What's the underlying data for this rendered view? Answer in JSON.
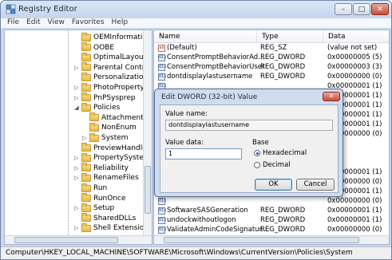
{
  "window": {
    "title": "Registry Editor",
    "min": "–",
    "max": "□",
    "close": "✕"
  },
  "menu": [
    "File",
    "Edit",
    "View",
    "Favorites",
    "Help"
  ],
  "tree": [
    {
      "label": "OEMInformation",
      "expander": "",
      "indent": 0
    },
    {
      "label": "OOBE",
      "expander": "",
      "indent": 0
    },
    {
      "label": "OptimalLayout",
      "expander": "",
      "indent": 0
    },
    {
      "label": "Parental Controls",
      "expander": "▷",
      "indent": 0
    },
    {
      "label": "Personalization",
      "expander": "",
      "indent": 0
    },
    {
      "label": "PhotoPropertyHandler",
      "expander": "▷",
      "indent": 0
    },
    {
      "label": "PnPSysprep",
      "expander": "▷",
      "indent": 0
    },
    {
      "label": "Policies",
      "expander": "◢",
      "indent": 0
    },
    {
      "label": "Attachments",
      "expander": "",
      "indent": 1
    },
    {
      "label": "NonEnum",
      "expander": "",
      "indent": 1
    },
    {
      "label": "System",
      "expander": "▷",
      "indent": 1
    },
    {
      "label": "PreviewHandlers",
      "expander": "",
      "indent": 0
    },
    {
      "label": "PropertySystem",
      "expander": "▷",
      "indent": 0
    },
    {
      "label": "Reliability",
      "expander": "▷",
      "indent": 0
    },
    {
      "label": "RenameFiles",
      "expander": "▷",
      "indent": 0
    },
    {
      "label": "Run",
      "expander": "",
      "indent": 0
    },
    {
      "label": "RunOnce",
      "expander": "",
      "indent": 0
    },
    {
      "label": "Setup",
      "expander": "▷",
      "indent": 0
    },
    {
      "label": "SharedDLLs",
      "expander": "",
      "indent": 0
    },
    {
      "label": "Shell Extensions",
      "expander": "▷",
      "indent": 0
    }
  ],
  "columns": {
    "name": "Name",
    "type": "Type",
    "data": "Data"
  },
  "values": [
    {
      "icon": "ab",
      "name": "(Default)",
      "type": "REG_SZ",
      "data": "(value not set)"
    },
    {
      "icon": "011",
      "name": "ConsentPromptBehaviorAd...",
      "type": "REG_DWORD",
      "data": "0x00000005 (5)"
    },
    {
      "icon": "011",
      "name": "ConsentPromptBehaviorUser",
      "type": "REG_DWORD",
      "data": "0x00000003 (3)"
    },
    {
      "icon": "011",
      "name": "dontdisplaylastusername",
      "type": "REG_DWORD",
      "data": "0x00000000 (0)"
    },
    {
      "icon": "011",
      "name": "",
      "type": "",
      "data": "0x00000001 (1)"
    },
    {
      "icon": "011",
      "name": "",
      "type": "",
      "data": "0x00000001 (1)"
    },
    {
      "icon": "011",
      "name": "",
      "type": "",
      "data": "0x00000001 (1)"
    },
    {
      "icon": "011",
      "name": "",
      "type": "",
      "data": "0x00000001 (1)"
    },
    {
      "icon": "011",
      "name": "",
      "type": "",
      "data": "0x00000001 (1)"
    },
    {
      "icon": "011",
      "name": "",
      "type": "",
      "data": "0x00000000 (0)"
    },
    {
      "icon": "011",
      "name": "",
      "type": "",
      "data": ""
    },
    {
      "icon": "011",
      "name": "",
      "type": "",
      "data": ""
    },
    {
      "icon": "011",
      "name": "",
      "type": "",
      "data": ""
    },
    {
      "icon": "011",
      "name": "",
      "type": "",
      "data": "0x00000001 (1)"
    },
    {
      "icon": "011",
      "name": "",
      "type": "",
      "data": "0x00000000 (0)"
    },
    {
      "icon": "011",
      "name": "",
      "type": "",
      "data": "0x00000001 (1)"
    },
    {
      "icon": "011",
      "name": "",
      "type": "",
      "data": "0x00000000 (0)"
    },
    {
      "icon": "011",
      "name": "SoftwareSASGeneration",
      "type": "REG_DWORD",
      "data": "0x00000001 (1)"
    },
    {
      "icon": "011",
      "name": "undockwithoutlogon",
      "type": "REG_DWORD",
      "data": "0x00000001 (1)"
    },
    {
      "icon": "011",
      "name": "ValidateAdminCodeSignatur...",
      "type": "REG_DWORD",
      "data": "0x00000000 (0)"
    }
  ],
  "statusbar": "Computer\\HKEY_LOCAL_MACHINE\\SOFTWARE\\Microsoft\\Windows\\CurrentVersion\\Policies\\System",
  "dialog": {
    "title": "Edit DWORD (32-bit) Value",
    "close": "✕",
    "value_name_label": "Value name:",
    "value_name": "dontdisplaylastusername",
    "value_data_label": "Value data:",
    "value_data": "1",
    "base_label": "Base",
    "hex_label": "Hexadecimal",
    "dec_label": "Decimal",
    "base_selected": "Hexadecimal",
    "ok": "OK",
    "cancel": "Cancel"
  },
  "scroll_arrows": {
    "left": "◂",
    "right": "▸",
    "grip": "⦙⦙⦙"
  }
}
